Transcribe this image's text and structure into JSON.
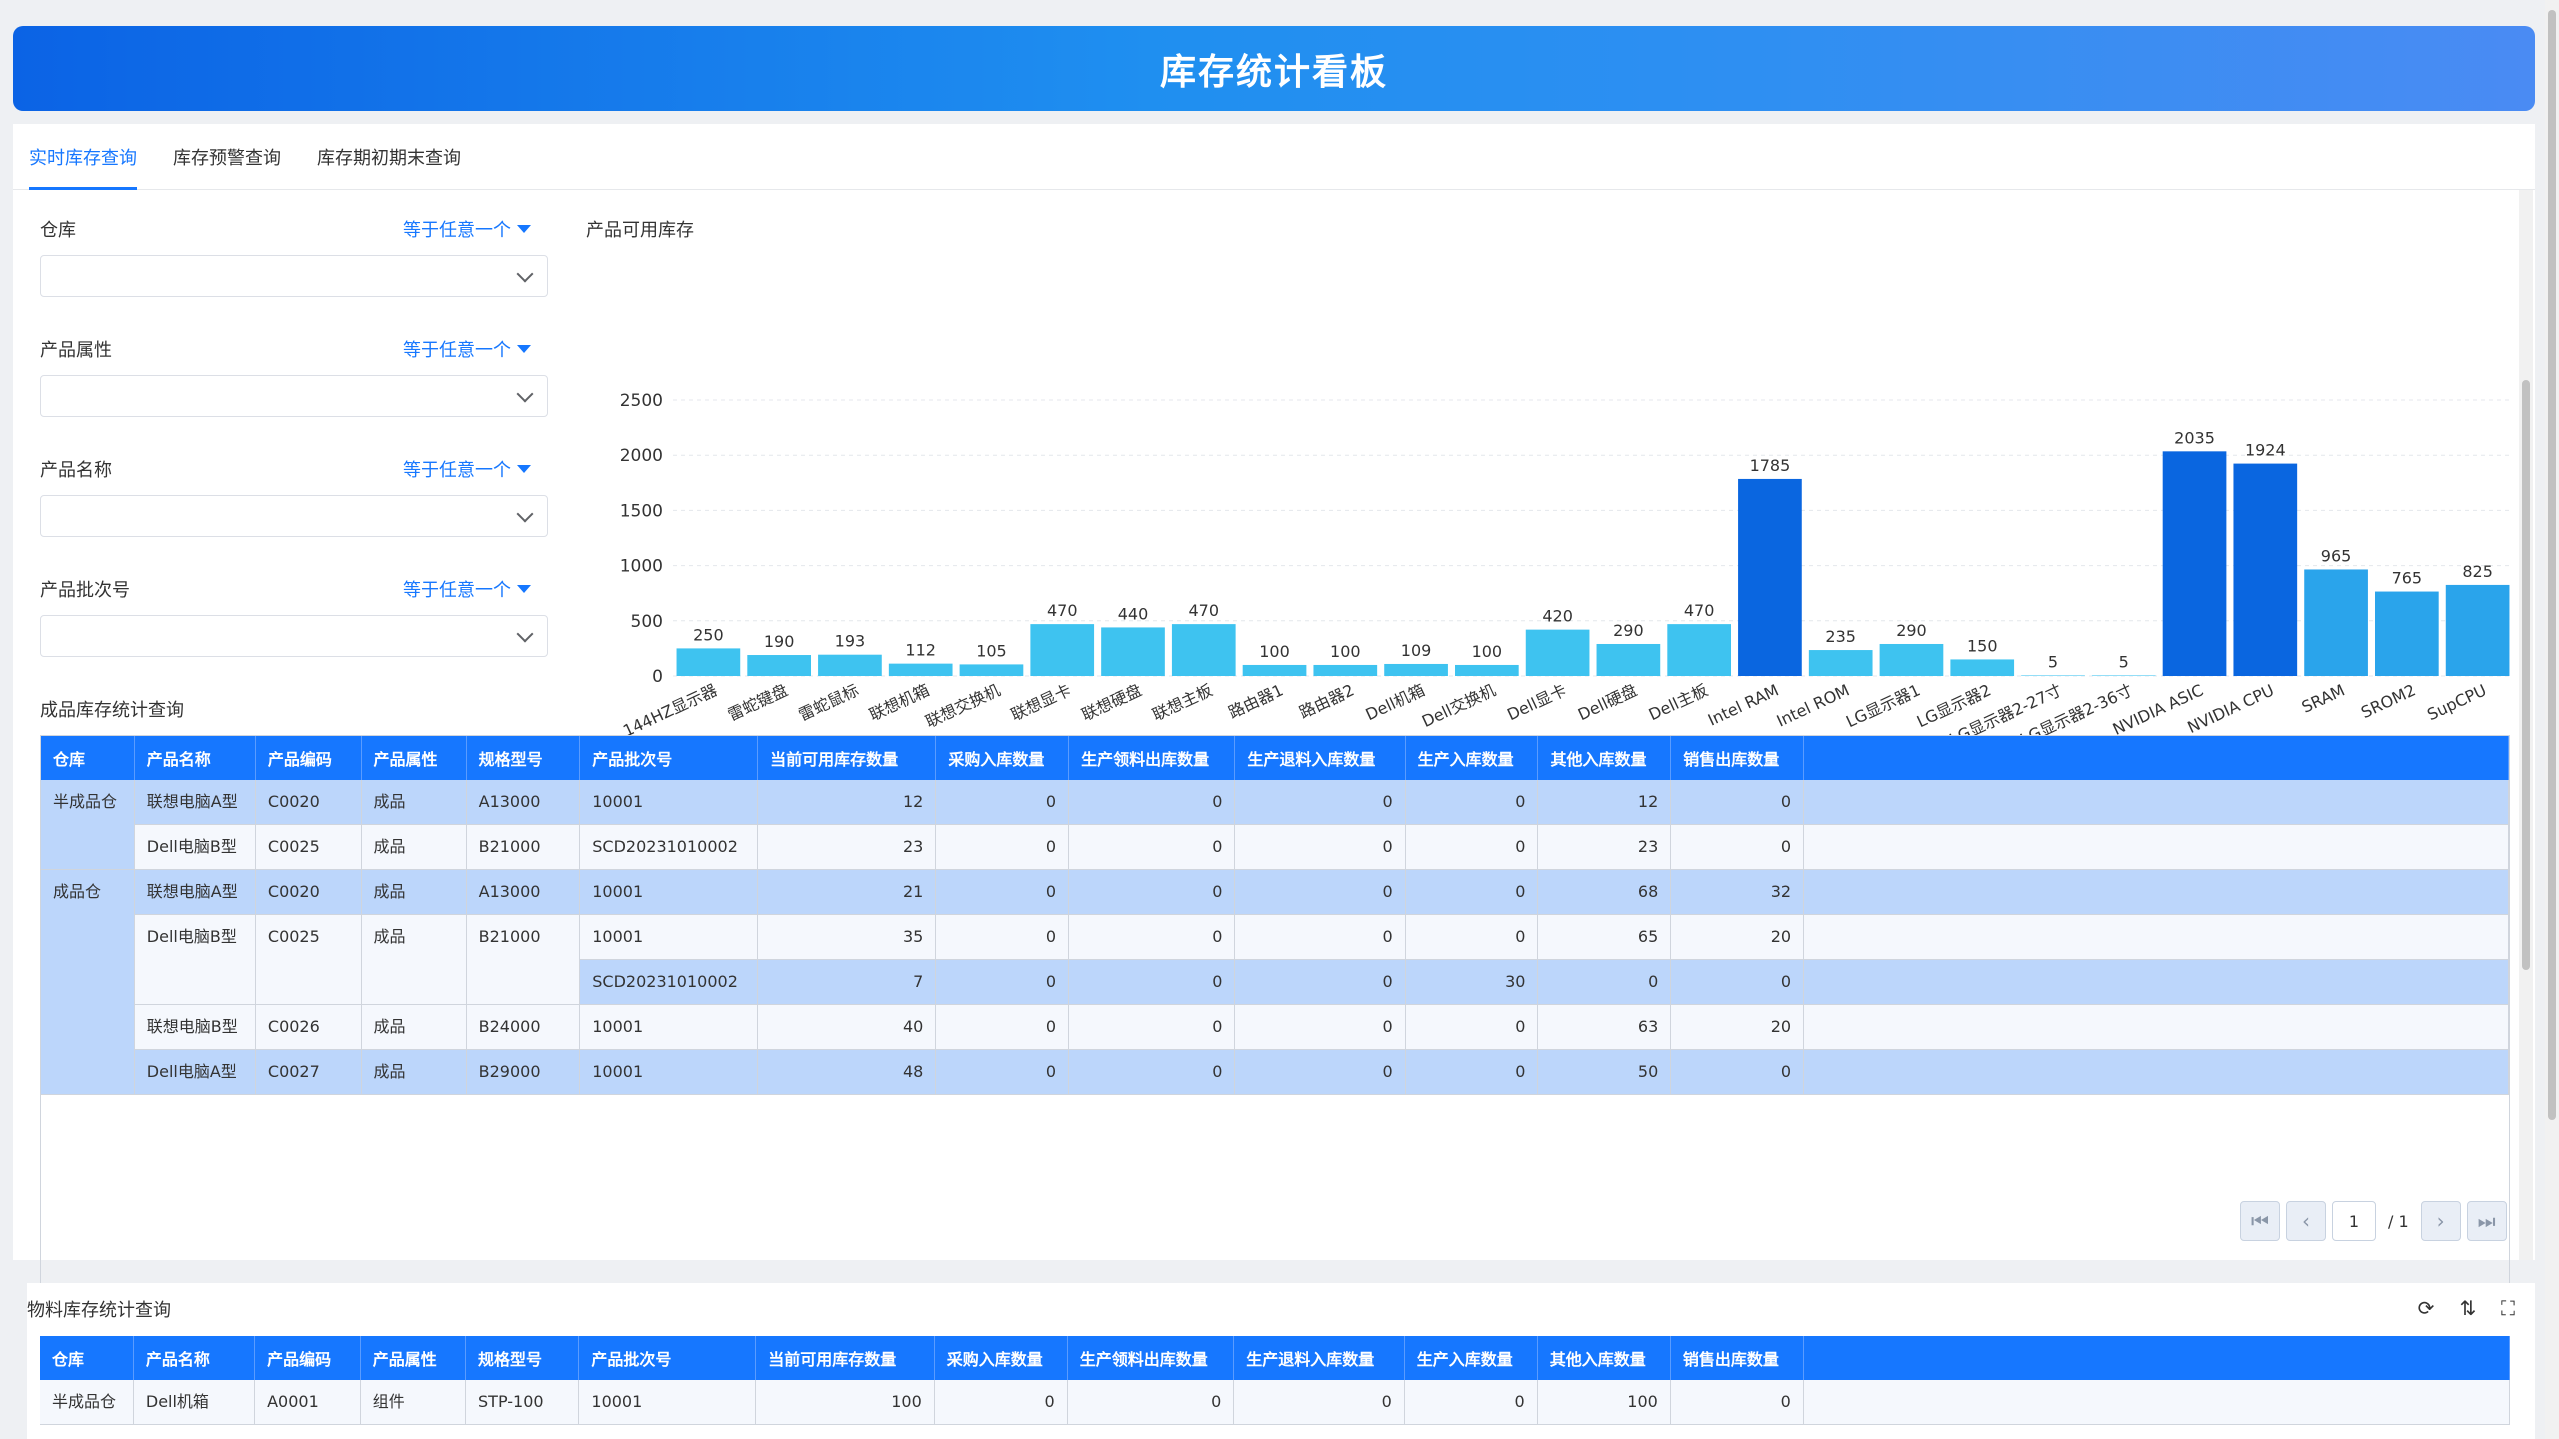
{
  "header": {
    "title": "库存统计看板"
  },
  "tabs": [
    {
      "label": "实时库存查询",
      "active": true
    },
    {
      "label": "库存预警查询",
      "active": false
    },
    {
      "label": "库存期初期末查询",
      "active": false
    }
  ],
  "filters": [
    {
      "label": "仓库",
      "operator": "等于任意一个",
      "value": ""
    },
    {
      "label": "产品属性",
      "operator": "等于任意一个",
      "value": ""
    },
    {
      "label": "产品名称",
      "operator": "等于任意一个",
      "value": ""
    },
    {
      "label": "产品批次号",
      "operator": "等于任意一个",
      "value": ""
    }
  ],
  "chart_title": "产品可用库存",
  "chart_data": {
    "type": "bar",
    "title": "产品可用库存",
    "ylim": [
      0,
      2500
    ],
    "yticks": [
      0,
      500,
      1000,
      1500,
      2000,
      2500
    ],
    "grid": true,
    "categories": [
      "144HZ显示器",
      "雷蛇键盘",
      "雷蛇鼠标",
      "联想机箱",
      "联想交换机",
      "联想显卡",
      "联想硬盘",
      "联想主板",
      "路由器1",
      "路由器2",
      "Dell机箱",
      "Dell交换机",
      "Dell显卡",
      "Dell硬盘",
      "Dell主板",
      "Intel RAM",
      "Intel ROM",
      "LG显示器1",
      "LG显示器2",
      "LG显示器2-27寸",
      "LG显示器2-36寸",
      "NVIDIA ASIC",
      "NVIDIA CPU",
      "SRAM",
      "SROM2",
      "SupCPU"
    ],
    "values": [
      250,
      190,
      193,
      112,
      105,
      470,
      440,
      470,
      100,
      100,
      109,
      100,
      420,
      290,
      470,
      1785,
      235,
      290,
      150,
      5,
      5,
      2035,
      1924,
      965,
      765,
      825
    ],
    "colors": {
      "light": "#3ec3f0",
      "medium": "#2aa4eb",
      "dark": "#0a66e0"
    }
  },
  "finished_table": {
    "title": "成品库存统计查询",
    "columns": [
      "仓库",
      "产品名称",
      "产品编码",
      "产品属性",
      "规格型号",
      "产品批次号",
      "当前可用库存数量",
      "采购入库数量",
      "生产领料出库数量",
      "生产退料入库数量",
      "生产入库数量",
      "其他入库数量",
      "销售出库数量"
    ],
    "groups": [
      {
        "warehouse": "半成品仓",
        "products": [
          {
            "name": "联想电脑A型",
            "code": "C0020",
            "attr": "成品",
            "spec": "A13000",
            "batches": [
              {
                "batch": "10001",
                "vals": [
                  "12",
                  "0",
                  "0",
                  "0",
                  "0",
                  "12",
                  "0"
                ]
              }
            ]
          },
          {
            "name": "Dell电脑B型",
            "code": "C0025",
            "attr": "成品",
            "spec": "B21000",
            "batches": [
              {
                "batch": "SCD20231010002",
                "vals": [
                  "23",
                  "0",
                  "0",
                  "0",
                  "0",
                  "23",
                  "0"
                ]
              }
            ]
          }
        ]
      },
      {
        "warehouse": "成品仓",
        "products": [
          {
            "name": "联想电脑A型",
            "code": "C0020",
            "attr": "成品",
            "spec": "A13000",
            "batches": [
              {
                "batch": "10001",
                "vals": [
                  "21",
                  "0",
                  "0",
                  "0",
                  "0",
                  "68",
                  "32"
                ]
              }
            ]
          },
          {
            "name": "Dell电脑B型",
            "code": "C0025",
            "attr": "成品",
            "spec": "B21000",
            "batches": [
              {
                "batch": "10001",
                "vals": [
                  "35",
                  "0",
                  "0",
                  "0",
                  "0",
                  "65",
                  "20"
                ]
              },
              {
                "batch": "SCD20231010002",
                "vals": [
                  "7",
                  "0",
                  "0",
                  "0",
                  "30",
                  "0",
                  "0"
                ]
              }
            ]
          },
          {
            "name": "联想电脑B型",
            "code": "C0026",
            "attr": "成品",
            "spec": "B24000",
            "batches": [
              {
                "batch": "10001",
                "vals": [
                  "40",
                  "0",
                  "0",
                  "0",
                  "0",
                  "63",
                  "20"
                ]
              }
            ]
          },
          {
            "name": "Dell电脑A型",
            "code": "C0027",
            "attr": "成品",
            "spec": "B29000",
            "batches": [
              {
                "batch": "10001",
                "vals": [
                  "48",
                  "0",
                  "0",
                  "0",
                  "0",
                  "50",
                  "0"
                ]
              }
            ]
          }
        ]
      }
    ]
  },
  "pagination": {
    "current": "1",
    "total": "/ 1"
  },
  "material_table": {
    "title": "物料库存统计查询",
    "columns": [
      "仓库",
      "产品名称",
      "产品编码",
      "产品属性",
      "规格型号",
      "产品批次号",
      "当前可用库存数量",
      "采购入库数量",
      "生产领料出库数量",
      "生产退料入库数量",
      "生产入库数量",
      "其他入库数量",
      "销售出库数量"
    ],
    "rows": [
      {
        "warehouse": "半成品仓",
        "name": "Dell机箱",
        "code": "A0001",
        "attr": "组件",
        "spec": "STP-100",
        "batch": "10001",
        "vals": [
          "100",
          "0",
          "0",
          "0",
          "0",
          "100",
          "0"
        ]
      }
    ]
  },
  "toolbar_icons": [
    "refresh-icon",
    "sort-icon",
    "fullscreen-icon"
  ]
}
